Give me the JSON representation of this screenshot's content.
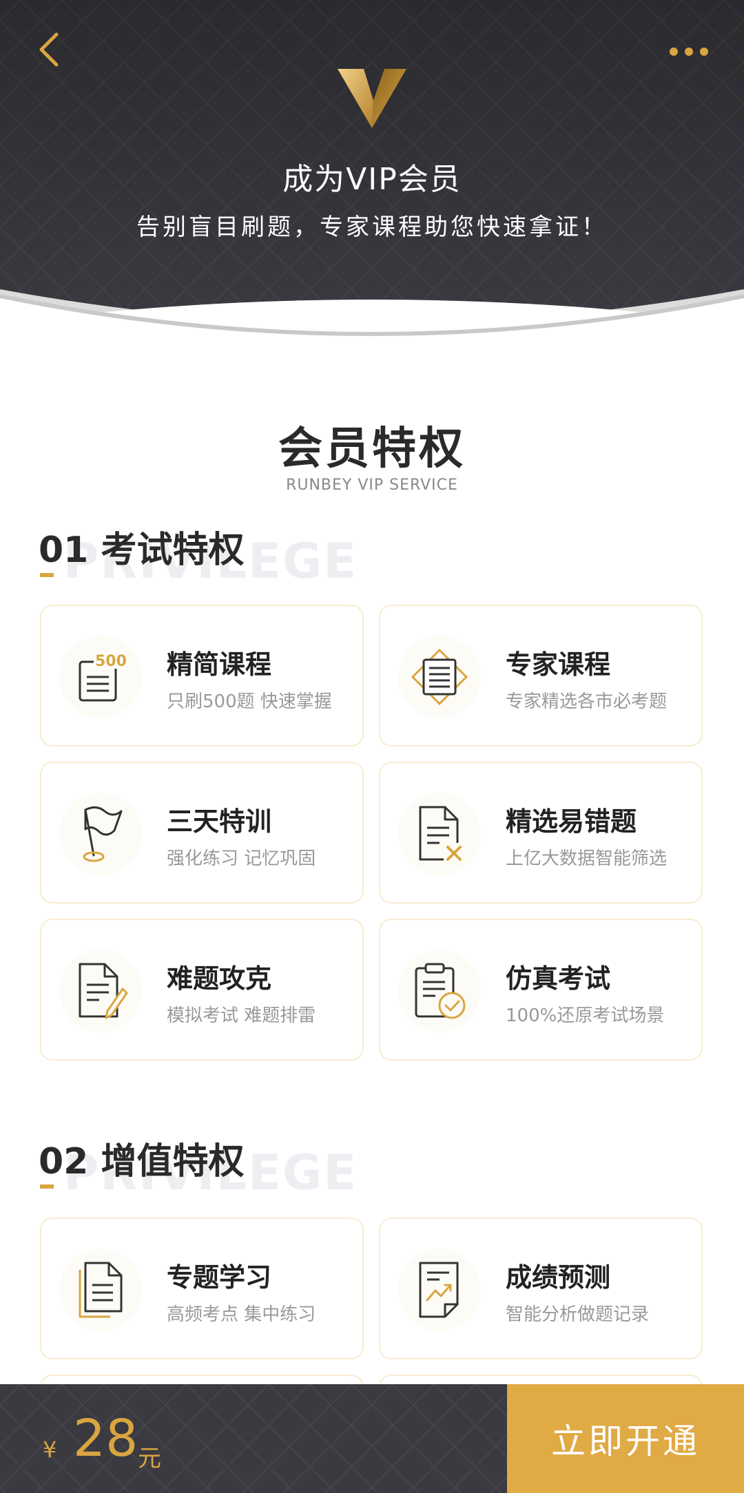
{
  "header": {
    "title": "成为VIP会员",
    "subtitle": "告别盲目刷题，专家课程助您快速拿证！"
  },
  "section": {
    "title": "会员特权",
    "subtitle": "RUNBEY VIP SERVICE"
  },
  "groups": [
    {
      "title": "01 考试特权",
      "watermark": "PRIVILEGE",
      "cards": [
        {
          "title": "精简课程",
          "desc": "只刷500题 快速掌握",
          "icon": "doc-500-icon"
        },
        {
          "title": "专家课程",
          "desc": "专家精选各市必考题",
          "icon": "expert-doc-icon"
        },
        {
          "title": "三天特训",
          "desc": "强化练习 记忆巩固",
          "icon": "flag-icon"
        },
        {
          "title": "精选易错题",
          "desc": "上亿大数据智能筛选",
          "icon": "doc-x-icon"
        },
        {
          "title": "难题攻克",
          "desc": "模拟考试 难题排雷",
          "icon": "doc-pencil-icon"
        },
        {
          "title": "仿真考试",
          "desc": "100%还原考试场景",
          "icon": "clipboard-check-icon"
        }
      ]
    },
    {
      "title": "02 增值特权",
      "watermark": "PRIVILEGE",
      "cards": [
        {
          "title": "专题学习",
          "desc": "高频考点 集中练习",
          "icon": "stacked-doc-icon"
        },
        {
          "title": "成绩预测",
          "desc": "智能分析做题记录",
          "icon": "trend-doc-icon"
        }
      ]
    }
  ],
  "bottom": {
    "currency": "¥",
    "price": "28",
    "unit": "元",
    "button": "立即开通"
  },
  "colors": {
    "gold": "#d9a540",
    "dark": "#2b2b30",
    "button": "#e0aa45"
  }
}
